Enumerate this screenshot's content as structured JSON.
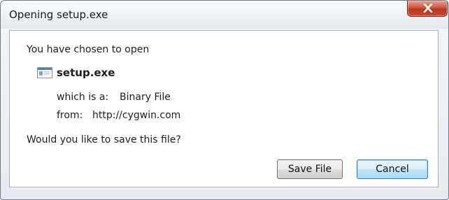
{
  "dialog": {
    "title": "Opening setup.exe",
    "intro": "You have chosen to open",
    "file": {
      "icon": "executable-file-icon",
      "name": "setup.exe",
      "type_label": "which is a:",
      "type_value": "Binary File",
      "from_label": "from:",
      "from_value": "http://cygwin.com"
    },
    "question": "Would you like to save this file?",
    "buttons": {
      "save": "Save File",
      "cancel": "Cancel"
    },
    "close_icon": "close-icon"
  },
  "colors": {
    "close_button": "#c9482f",
    "default_button_border": "#3c7fb1"
  }
}
